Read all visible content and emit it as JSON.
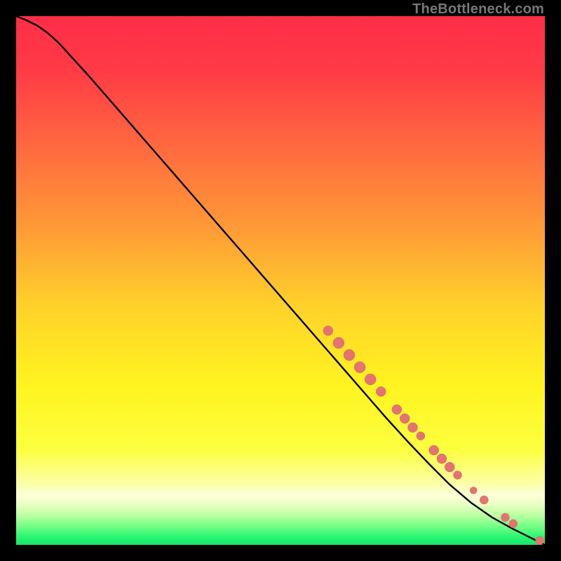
{
  "attribution": "TheBottleneck.com",
  "colors": {
    "curve": "#000000",
    "point_fill": "#e57373",
    "point_stroke": "#d46262",
    "frame": "#000000"
  },
  "chart_data": {
    "type": "line",
    "title": "",
    "xlabel": "",
    "ylabel": "",
    "xlim": [
      0,
      100
    ],
    "ylim": [
      0,
      100
    ],
    "grid": false,
    "legend": false,
    "curve": {
      "x": [
        0,
        2,
        4,
        6,
        8,
        10,
        14,
        18,
        22,
        26,
        30,
        34,
        38,
        42,
        46,
        50,
        54,
        58,
        62,
        66,
        70,
        74,
        78,
        82,
        86,
        90,
        94,
        98,
        100
      ],
      "y": [
        100,
        99.2,
        98.2,
        96.8,
        95.0,
        92.8,
        88.4,
        83.8,
        79.2,
        74.6,
        70.0,
        65.4,
        60.8,
        56.2,
        51.6,
        47.0,
        42.4,
        37.8,
        33.2,
        28.6,
        24.0,
        19.6,
        15.4,
        11.4,
        8.0,
        5.2,
        3.0,
        1.0,
        0.0
      ]
    },
    "series": [
      {
        "name": "points",
        "marker": "circle",
        "color": "#e57373",
        "points": [
          {
            "x": 59.0,
            "y": 40.5,
            "r": 7
          },
          {
            "x": 61.0,
            "y": 38.2,
            "r": 8
          },
          {
            "x": 63.0,
            "y": 35.9,
            "r": 8
          },
          {
            "x": 65.0,
            "y": 33.6,
            "r": 8
          },
          {
            "x": 67.0,
            "y": 31.3,
            "r": 8
          },
          {
            "x": 69.0,
            "y": 29.0,
            "r": 7
          },
          {
            "x": 72.0,
            "y": 25.6,
            "r": 7
          },
          {
            "x": 73.5,
            "y": 23.9,
            "r": 7
          },
          {
            "x": 75.0,
            "y": 22.2,
            "r": 7
          },
          {
            "x": 76.5,
            "y": 20.6,
            "r": 6
          },
          {
            "x": 79.0,
            "y": 17.9,
            "r": 7
          },
          {
            "x": 80.5,
            "y": 16.3,
            "r": 7
          },
          {
            "x": 82.0,
            "y": 14.7,
            "r": 7
          },
          {
            "x": 83.5,
            "y": 13.2,
            "r": 6
          },
          {
            "x": 86.5,
            "y": 10.3,
            "r": 5
          },
          {
            "x": 88.5,
            "y": 8.5,
            "r": 6
          },
          {
            "x": 92.5,
            "y": 5.2,
            "r": 6
          },
          {
            "x": 94.0,
            "y": 4.0,
            "r": 6
          },
          {
            "x": 99.0,
            "y": 0.8,
            "r": 6
          }
        ]
      }
    ]
  }
}
